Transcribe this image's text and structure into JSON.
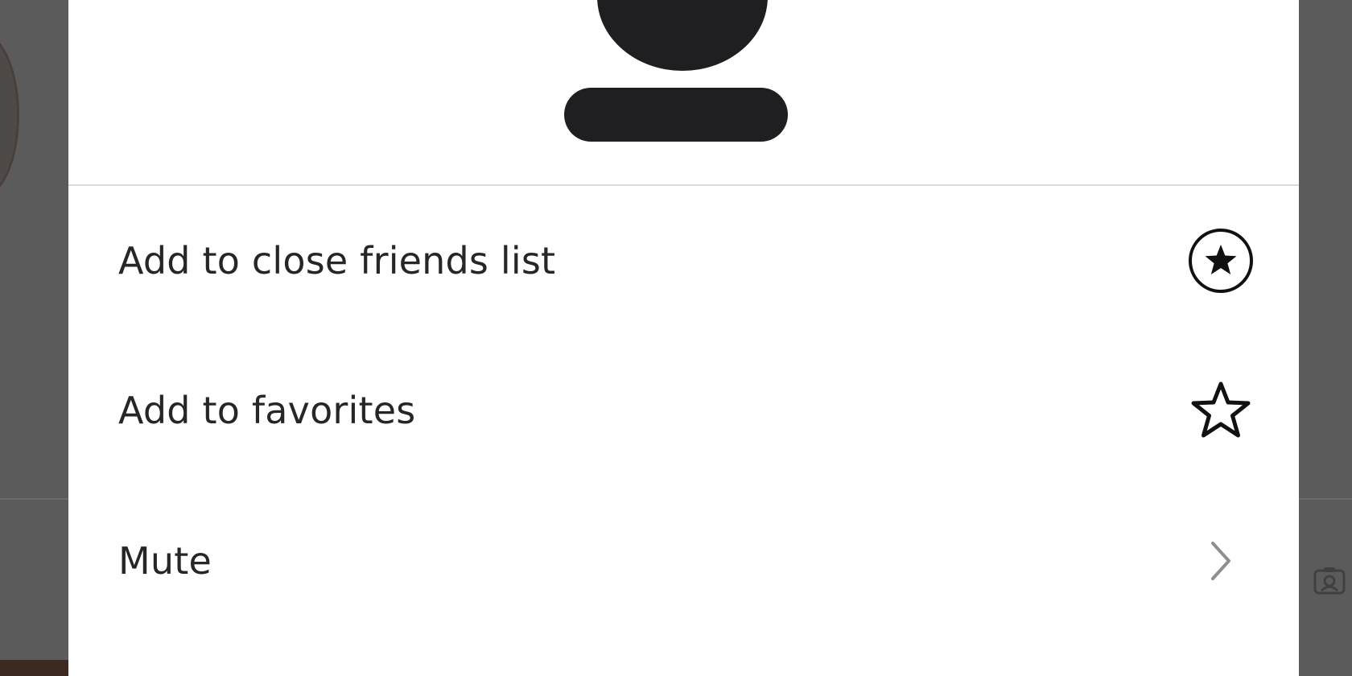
{
  "menu": {
    "items": [
      {
        "label": "Add to close friends list",
        "icon": "close-friends-star-circle-icon"
      },
      {
        "label": "Add to favorites",
        "icon": "star-outline-icon"
      },
      {
        "label": "Mute",
        "icon": "chevron-right-icon"
      }
    ]
  },
  "colors": {
    "text": "#262626",
    "overlay": "#5b5b5b",
    "divider": "#dbdbdb",
    "redaction": "#1f1f21",
    "chevron": "#8e8e8e"
  }
}
